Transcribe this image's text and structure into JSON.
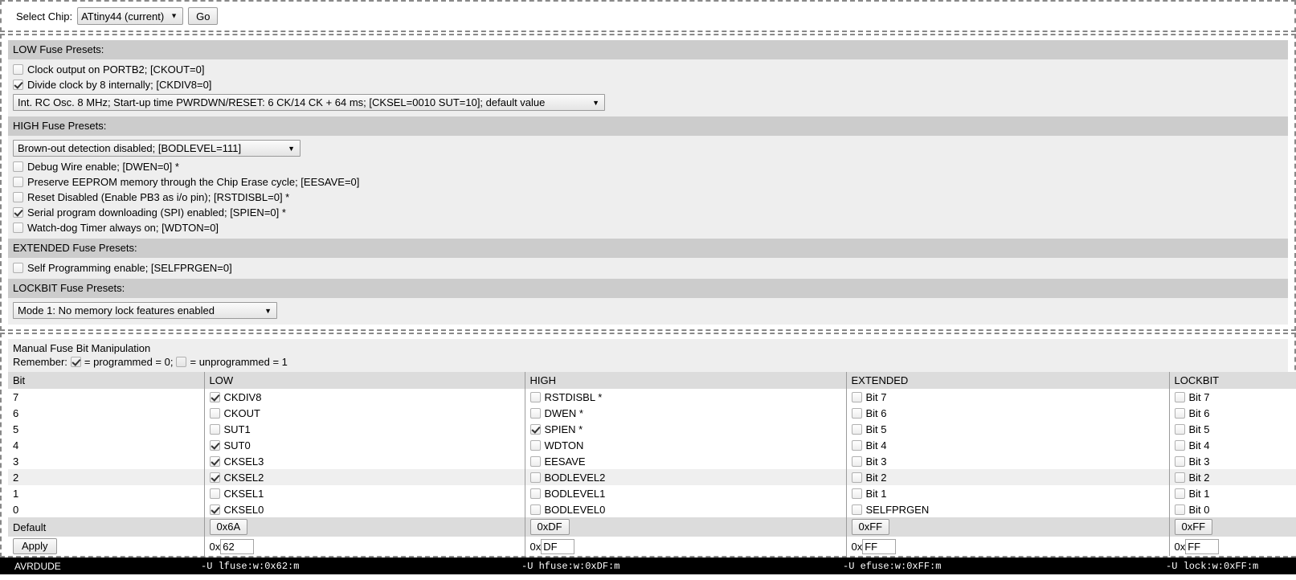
{
  "chip_selector": {
    "label": "Select Chip:",
    "selected": "ATtiny44 (current)",
    "go_label": "Go",
    "dropdown_icon": "chevron-down-icon"
  },
  "presets": {
    "low": {
      "header": "LOW Fuse Presets:",
      "checkboxes": [
        {
          "label": "Clock output on PORTB2; [CKOUT=0]",
          "checked": false
        },
        {
          "label": "Divide clock by 8 internally; [CKDIV8=0]",
          "checked": true
        }
      ],
      "clock_select": "Int. RC Osc. 8 MHz; Start-up time PWRDWN/RESET: 6 CK/14 CK + 64 ms; [CKSEL=0010 SUT=10]; default value"
    },
    "high": {
      "header": "HIGH Fuse Presets:",
      "bod_select": "Brown-out detection disabled; [BODLEVEL=111]",
      "checkboxes": [
        {
          "label": "Debug Wire enable; [DWEN=0] *",
          "checked": false
        },
        {
          "label": "Preserve EEPROM memory through the Chip Erase cycle; [EESAVE=0]",
          "checked": false
        },
        {
          "label": "Reset Disabled (Enable PB3 as i/o pin); [RSTDISBL=0] *",
          "checked": false
        },
        {
          "label": "Serial program downloading (SPI) enabled; [SPIEN=0] *",
          "checked": true
        },
        {
          "label": "Watch-dog Timer always on; [WDTON=0]",
          "checked": false
        }
      ]
    },
    "extended": {
      "header": "EXTENDED Fuse Presets:",
      "checkboxes": [
        {
          "label": "Self Programming enable; [SELFPRGEN=0]",
          "checked": false
        }
      ]
    },
    "lockbit": {
      "header": "LOCKBIT Fuse Presets:",
      "mode_select": "Mode 1: No memory lock features enabled"
    }
  },
  "manual": {
    "title": "Manual Fuse Bit Manipulation",
    "remember_prefix": "Remember:",
    "remember_mid": "= programmed = 0;",
    "remember_end": "= unprogrammed = 1",
    "columns": [
      "Bit",
      "LOW",
      "HIGH",
      "EXTENDED",
      "LOCKBIT"
    ],
    "rows": [
      {
        "bit": "7",
        "low": {
          "label": "CKDIV8",
          "checked": true
        },
        "high": {
          "label": "RSTDISBL *",
          "checked": false
        },
        "extended": {
          "label": "Bit 7",
          "checked": false
        },
        "lockbit": {
          "label": "Bit 7",
          "checked": false
        },
        "highlight": false
      },
      {
        "bit": "6",
        "low": {
          "label": "CKOUT",
          "checked": false
        },
        "high": {
          "label": "DWEN *",
          "checked": false
        },
        "extended": {
          "label": "Bit 6",
          "checked": false
        },
        "lockbit": {
          "label": "Bit 6",
          "checked": false
        },
        "highlight": false
      },
      {
        "bit": "5",
        "low": {
          "label": "SUT1",
          "checked": false
        },
        "high": {
          "label": "SPIEN *",
          "checked": true
        },
        "extended": {
          "label": "Bit 5",
          "checked": false
        },
        "lockbit": {
          "label": "Bit 5",
          "checked": false
        },
        "highlight": false
      },
      {
        "bit": "4",
        "low": {
          "label": "SUT0",
          "checked": true
        },
        "high": {
          "label": "WDTON",
          "checked": false
        },
        "extended": {
          "label": "Bit 4",
          "checked": false
        },
        "lockbit": {
          "label": "Bit 4",
          "checked": false
        },
        "highlight": false
      },
      {
        "bit": "3",
        "low": {
          "label": "CKSEL3",
          "checked": true
        },
        "high": {
          "label": "EESAVE",
          "checked": false
        },
        "extended": {
          "label": "Bit 3",
          "checked": false
        },
        "lockbit": {
          "label": "Bit 3",
          "checked": false
        },
        "highlight": false
      },
      {
        "bit": "2",
        "low": {
          "label": "CKSEL2",
          "checked": true
        },
        "high": {
          "label": "BODLEVEL2",
          "checked": false
        },
        "extended": {
          "label": "Bit 2",
          "checked": false
        },
        "lockbit": {
          "label": "Bit 2",
          "checked": false
        },
        "highlight": true
      },
      {
        "bit": "1",
        "low": {
          "label": "CKSEL1",
          "checked": false
        },
        "high": {
          "label": "BODLEVEL1",
          "checked": false
        },
        "extended": {
          "label": "Bit 1",
          "checked": false
        },
        "lockbit": {
          "label": "Bit 1",
          "checked": false
        },
        "highlight": false
      },
      {
        "bit": "0",
        "low": {
          "label": "CKSEL0",
          "checked": true
        },
        "high": {
          "label": "BODLEVEL0",
          "checked": false
        },
        "extended": {
          "label": "SELFPRGEN",
          "checked": false
        },
        "lockbit": {
          "label": "Bit 0",
          "checked": false
        },
        "highlight": false
      }
    ],
    "default_row": {
      "label": "Default",
      "low": "0x6A",
      "high": "0xDF",
      "extended": "0xFF",
      "lockbit": "0xFF"
    },
    "apply_row": {
      "apply_label": "Apply",
      "hex_prefix": "0x",
      "low_value": "62",
      "high_value": "DF",
      "extended_value": "FF",
      "lockbit_value": "FF"
    }
  },
  "avrdude": {
    "label": "AVRDUDE",
    "low_cmd": "-U lfuse:w:0x62:m",
    "high_cmd": "-U hfuse:w:0xDF:m",
    "extended_cmd": "-U efuse:w:0xFF:m",
    "lockbit_cmd": "-U lock:w:0xFF:m"
  },
  "colors": {
    "section_header_bg": "#cccccc",
    "section_body_bg": "#eeeeee",
    "table_header_bg": "#dcdcdc",
    "avrdude_bg": "#000000",
    "avrdude_fg": "#ffffff"
  }
}
